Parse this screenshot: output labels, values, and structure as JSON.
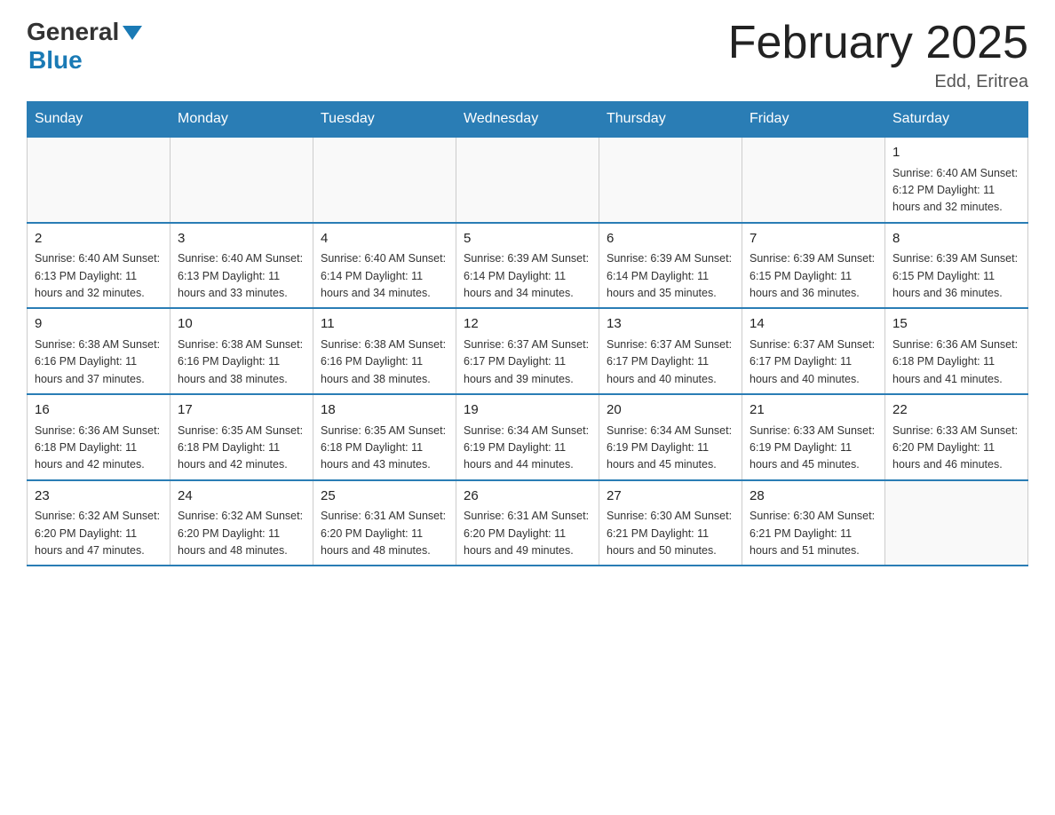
{
  "header": {
    "logo_general": "General",
    "logo_blue": "Blue",
    "title": "February 2025",
    "location": "Edd, Eritrea"
  },
  "days_of_week": [
    "Sunday",
    "Monday",
    "Tuesday",
    "Wednesday",
    "Thursday",
    "Friday",
    "Saturday"
  ],
  "weeks": [
    [
      {
        "day": "",
        "info": ""
      },
      {
        "day": "",
        "info": ""
      },
      {
        "day": "",
        "info": ""
      },
      {
        "day": "",
        "info": ""
      },
      {
        "day": "",
        "info": ""
      },
      {
        "day": "",
        "info": ""
      },
      {
        "day": "1",
        "info": "Sunrise: 6:40 AM\nSunset: 6:12 PM\nDaylight: 11 hours\nand 32 minutes."
      }
    ],
    [
      {
        "day": "2",
        "info": "Sunrise: 6:40 AM\nSunset: 6:13 PM\nDaylight: 11 hours\nand 32 minutes."
      },
      {
        "day": "3",
        "info": "Sunrise: 6:40 AM\nSunset: 6:13 PM\nDaylight: 11 hours\nand 33 minutes."
      },
      {
        "day": "4",
        "info": "Sunrise: 6:40 AM\nSunset: 6:14 PM\nDaylight: 11 hours\nand 34 minutes."
      },
      {
        "day": "5",
        "info": "Sunrise: 6:39 AM\nSunset: 6:14 PM\nDaylight: 11 hours\nand 34 minutes."
      },
      {
        "day": "6",
        "info": "Sunrise: 6:39 AM\nSunset: 6:14 PM\nDaylight: 11 hours\nand 35 minutes."
      },
      {
        "day": "7",
        "info": "Sunrise: 6:39 AM\nSunset: 6:15 PM\nDaylight: 11 hours\nand 36 minutes."
      },
      {
        "day": "8",
        "info": "Sunrise: 6:39 AM\nSunset: 6:15 PM\nDaylight: 11 hours\nand 36 minutes."
      }
    ],
    [
      {
        "day": "9",
        "info": "Sunrise: 6:38 AM\nSunset: 6:16 PM\nDaylight: 11 hours\nand 37 minutes."
      },
      {
        "day": "10",
        "info": "Sunrise: 6:38 AM\nSunset: 6:16 PM\nDaylight: 11 hours\nand 38 minutes."
      },
      {
        "day": "11",
        "info": "Sunrise: 6:38 AM\nSunset: 6:16 PM\nDaylight: 11 hours\nand 38 minutes."
      },
      {
        "day": "12",
        "info": "Sunrise: 6:37 AM\nSunset: 6:17 PM\nDaylight: 11 hours\nand 39 minutes."
      },
      {
        "day": "13",
        "info": "Sunrise: 6:37 AM\nSunset: 6:17 PM\nDaylight: 11 hours\nand 40 minutes."
      },
      {
        "day": "14",
        "info": "Sunrise: 6:37 AM\nSunset: 6:17 PM\nDaylight: 11 hours\nand 40 minutes."
      },
      {
        "day": "15",
        "info": "Sunrise: 6:36 AM\nSunset: 6:18 PM\nDaylight: 11 hours\nand 41 minutes."
      }
    ],
    [
      {
        "day": "16",
        "info": "Sunrise: 6:36 AM\nSunset: 6:18 PM\nDaylight: 11 hours\nand 42 minutes."
      },
      {
        "day": "17",
        "info": "Sunrise: 6:35 AM\nSunset: 6:18 PM\nDaylight: 11 hours\nand 42 minutes."
      },
      {
        "day": "18",
        "info": "Sunrise: 6:35 AM\nSunset: 6:18 PM\nDaylight: 11 hours\nand 43 minutes."
      },
      {
        "day": "19",
        "info": "Sunrise: 6:34 AM\nSunset: 6:19 PM\nDaylight: 11 hours\nand 44 minutes."
      },
      {
        "day": "20",
        "info": "Sunrise: 6:34 AM\nSunset: 6:19 PM\nDaylight: 11 hours\nand 45 minutes."
      },
      {
        "day": "21",
        "info": "Sunrise: 6:33 AM\nSunset: 6:19 PM\nDaylight: 11 hours\nand 45 minutes."
      },
      {
        "day": "22",
        "info": "Sunrise: 6:33 AM\nSunset: 6:20 PM\nDaylight: 11 hours\nand 46 minutes."
      }
    ],
    [
      {
        "day": "23",
        "info": "Sunrise: 6:32 AM\nSunset: 6:20 PM\nDaylight: 11 hours\nand 47 minutes."
      },
      {
        "day": "24",
        "info": "Sunrise: 6:32 AM\nSunset: 6:20 PM\nDaylight: 11 hours\nand 48 minutes."
      },
      {
        "day": "25",
        "info": "Sunrise: 6:31 AM\nSunset: 6:20 PM\nDaylight: 11 hours\nand 48 minutes."
      },
      {
        "day": "26",
        "info": "Sunrise: 6:31 AM\nSunset: 6:20 PM\nDaylight: 11 hours\nand 49 minutes."
      },
      {
        "day": "27",
        "info": "Sunrise: 6:30 AM\nSunset: 6:21 PM\nDaylight: 11 hours\nand 50 minutes."
      },
      {
        "day": "28",
        "info": "Sunrise: 6:30 AM\nSunset: 6:21 PM\nDaylight: 11 hours\nand 51 minutes."
      },
      {
        "day": "",
        "info": ""
      }
    ]
  ]
}
